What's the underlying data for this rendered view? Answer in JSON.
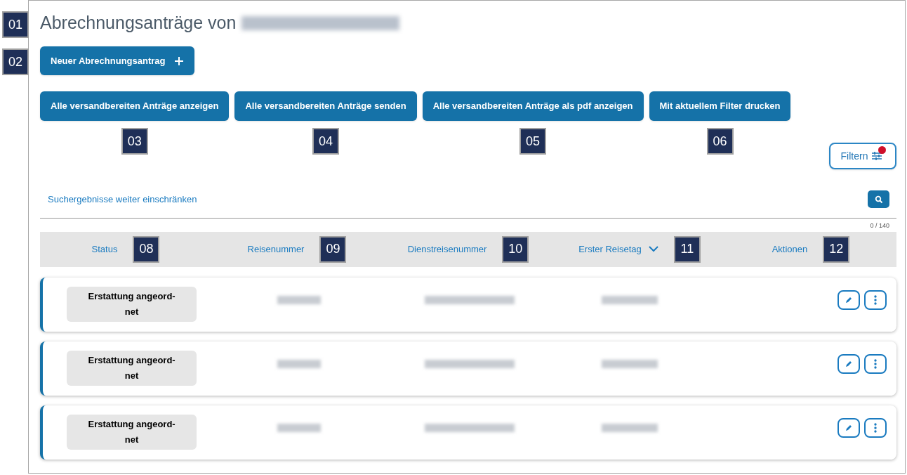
{
  "title": {
    "text": "Abrechnungsanträge von",
    "callout": "01"
  },
  "new_button": {
    "label": "Neuer Abrechnungsantrag",
    "callout": "02"
  },
  "action_buttons": [
    {
      "label": "Alle versandbereiten Anträge anzeigen",
      "callout": "03"
    },
    {
      "label": "Alle versandbereiten Anträge senden",
      "callout": "04"
    },
    {
      "label": "Alle versandbereiten Anträge als pdf anzeigen",
      "callout": "05"
    },
    {
      "label": "Mit aktuellem Filter drucken",
      "callout": "06"
    }
  ],
  "filter_button": {
    "label": "Filtern",
    "active": true
  },
  "search_link": "Suchergebnisse weiter einschränken",
  "count": "0 / 140",
  "columns": [
    {
      "label": "Status",
      "callout": "08",
      "sorted": false
    },
    {
      "label": "Reisenummer",
      "callout": "09",
      "sorted": false
    },
    {
      "label": "Dienstreisenummer",
      "callout": "10",
      "sorted": false
    },
    {
      "label": "Erster Reisetag",
      "callout": "11",
      "sorted": true
    },
    {
      "label": "Aktionen",
      "callout": "12",
      "sorted": false
    }
  ],
  "rows": [
    {
      "status": "Erstattung angeord-net"
    },
    {
      "status": "Erstattung angeord-net"
    },
    {
      "status": "Erstattung angeord-net"
    }
  ]
}
